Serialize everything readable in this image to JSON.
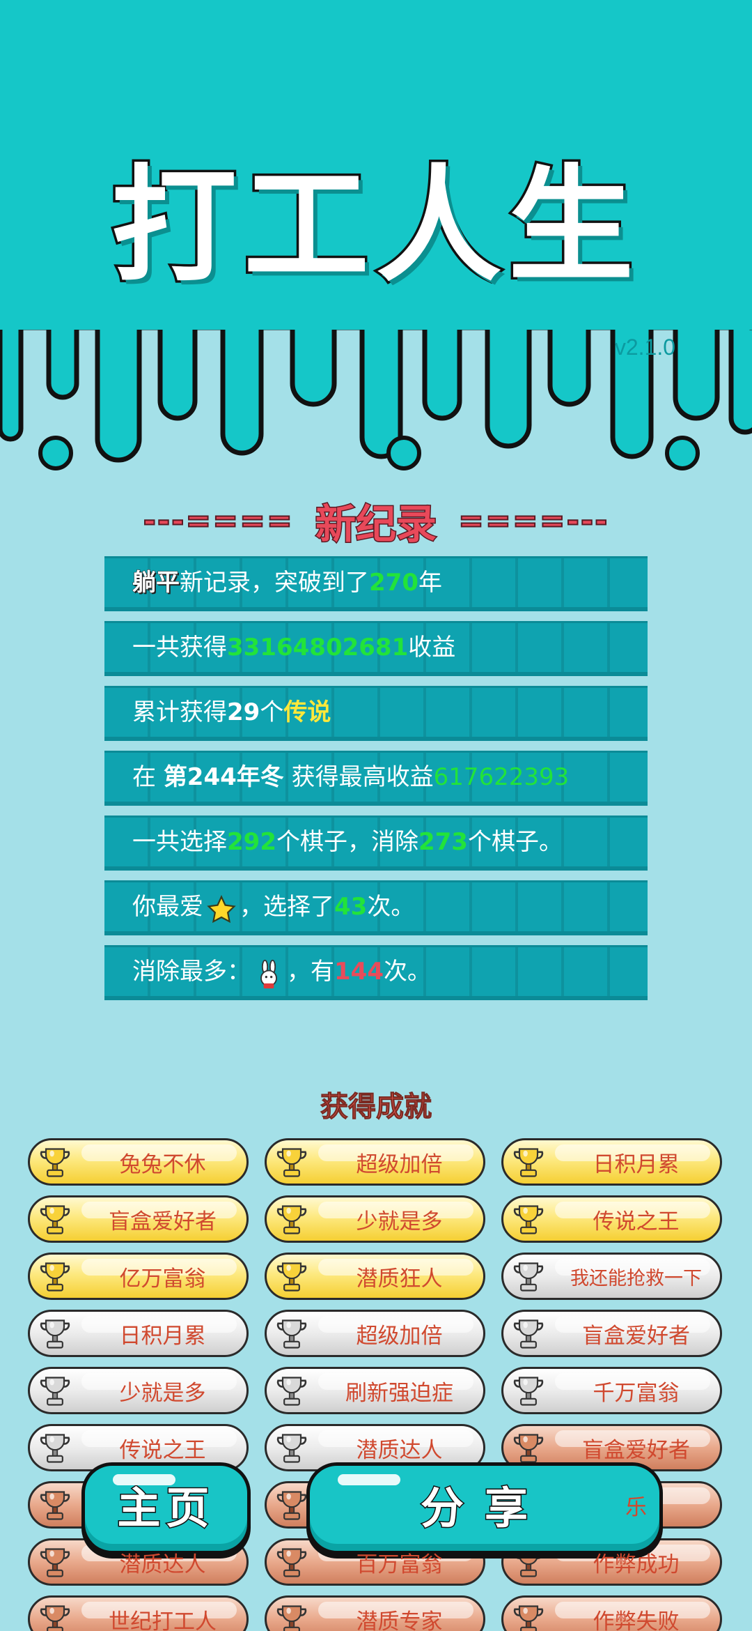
{
  "app": {
    "title": "打工人生",
    "version": "v2.1.0"
  },
  "record": {
    "dashes_left": "---====",
    "title": "新纪录",
    "dashes_right": "====---",
    "lines": [
      {
        "parts": [
          {
            "t": "躺平",
            "c": "tag"
          },
          {
            "t": "新记录，突破到了"
          },
          {
            "t": "270",
            "c": "g"
          },
          {
            "t": "年"
          }
        ]
      },
      {
        "parts": [
          {
            "t": "一共获得"
          },
          {
            "t": "33164802681",
            "c": "g"
          },
          {
            "t": "收益"
          }
        ]
      },
      {
        "parts": [
          {
            "t": "累计获得"
          },
          {
            "t": "29",
            "c": "b"
          },
          {
            "t": "个"
          },
          {
            "t": "传说",
            "c": "y"
          }
        ]
      },
      {
        "parts": [
          {
            "t": "在 "
          },
          {
            "t": "第244年冬",
            "c": "b"
          },
          {
            "t": " 获得最高收益"
          },
          {
            "t": "617622393",
            "c": "g2"
          }
        ]
      },
      {
        "parts": [
          {
            "t": "一共选择"
          },
          {
            "t": "292",
            "c": "g"
          },
          {
            "t": "个棋子，消除"
          },
          {
            "t": "273",
            "c": "g"
          },
          {
            "t": "个棋子。"
          }
        ]
      },
      {
        "parts": [
          {
            "t": "你最爱"
          },
          {
            "icon": "star-icon"
          },
          {
            "t": "，选择了"
          },
          {
            "t": "43",
            "c": "g"
          },
          {
            "t": "次。"
          }
        ]
      },
      {
        "parts": [
          {
            "t": "消除最多："
          },
          {
            "icon": "rabbit-icon"
          },
          {
            "t": "，有"
          },
          {
            "t": "144",
            "c": "r"
          },
          {
            "t": "次。"
          }
        ]
      }
    ]
  },
  "achievements": {
    "title": "获得成就",
    "items": [
      {
        "label": "兔兔不休",
        "tier": "gold"
      },
      {
        "label": "超级加倍",
        "tier": "gold"
      },
      {
        "label": "日积月累",
        "tier": "gold"
      },
      {
        "label": "盲盒爱好者",
        "tier": "gold"
      },
      {
        "label": "少就是多",
        "tier": "gold"
      },
      {
        "label": "传说之王",
        "tier": "gold"
      },
      {
        "label": "亿万富翁",
        "tier": "gold"
      },
      {
        "label": "潜质狂人",
        "tier": "gold"
      },
      {
        "label": "我还能抢救一下",
        "tier": "silver"
      },
      {
        "label": "日积月累",
        "tier": "silver"
      },
      {
        "label": "超级加倍",
        "tier": "silver"
      },
      {
        "label": "盲盒爱好者",
        "tier": "silver"
      },
      {
        "label": "少就是多",
        "tier": "silver"
      },
      {
        "label": "刷新强迫症",
        "tier": "silver"
      },
      {
        "label": "千万富翁",
        "tier": "silver"
      },
      {
        "label": "传说之王",
        "tier": "silver"
      },
      {
        "label": "潜质达人",
        "tier": "silver"
      },
      {
        "label": "盲盒爱好者",
        "tier": "bronze"
      },
      {
        "label": "",
        "tier": "bronze"
      },
      {
        "label": "",
        "tier": "bronze"
      },
      {
        "label": "乐",
        "tier": "bronze"
      },
      {
        "label": "潜质达人",
        "tier": "bronze"
      },
      {
        "label": "百万富翁",
        "tier": "bronze"
      },
      {
        "label": "作弊成功",
        "tier": "bronze"
      },
      {
        "label": "世纪打工人",
        "tier": "bronze"
      },
      {
        "label": "潜质专家",
        "tier": "bronze"
      },
      {
        "label": "作弊失败",
        "tier": "bronze"
      }
    ]
  },
  "buttons": {
    "home": "主页",
    "share": "分享"
  },
  "colors": {
    "top_bg": "#15c7c8",
    "page_bg": "#a4e0e8",
    "stat_bg": "#0fa3b0",
    "accent_red": "#e8495a",
    "green": "#22e33a",
    "yellow": "#ffe83a"
  }
}
